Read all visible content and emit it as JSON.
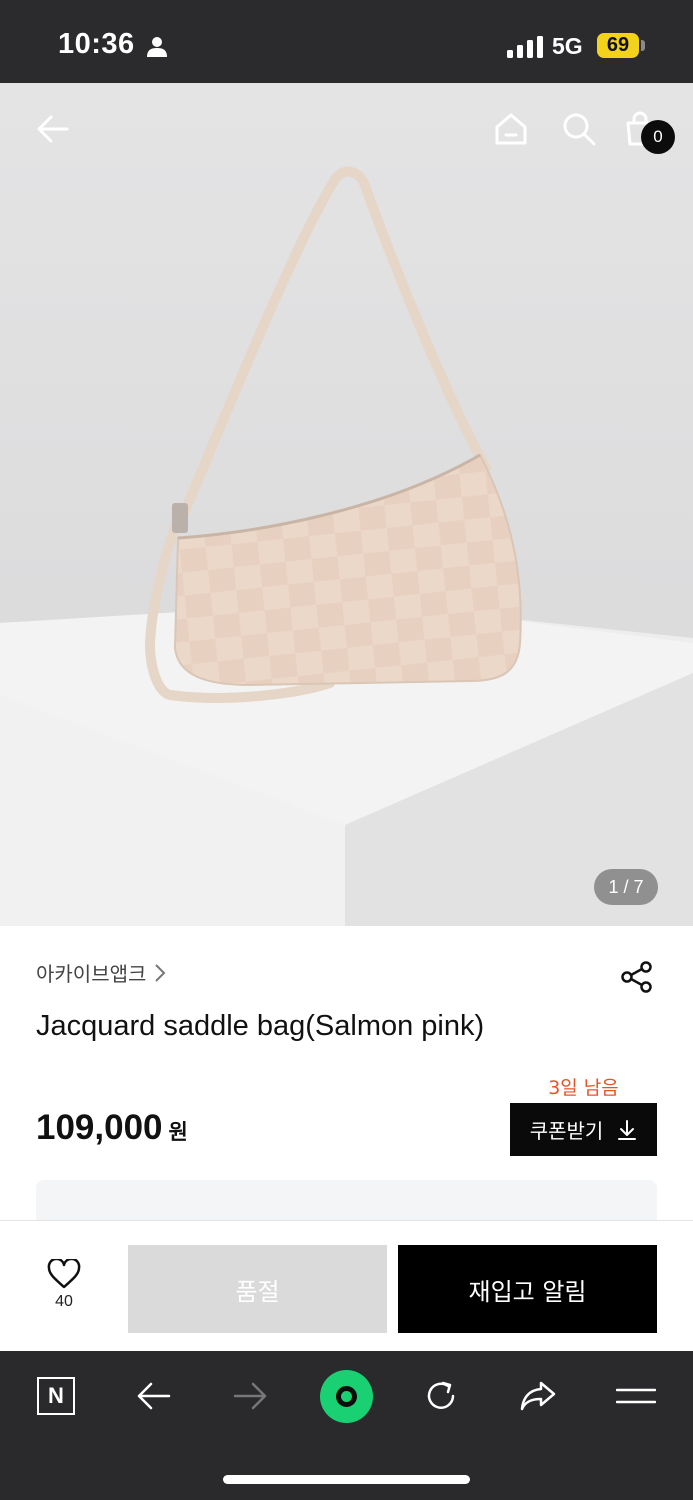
{
  "status_bar": {
    "time": "10:36",
    "network": "5G",
    "battery": "69",
    "icons": [
      "person-icon",
      "signal-bars-icon"
    ]
  },
  "header": {
    "icons": [
      "back-arrow-icon",
      "home-icon",
      "search-icon",
      "shopping-bag-icon"
    ],
    "cart_count": "0"
  },
  "gallery": {
    "page_indicator": "1 / 7"
  },
  "product": {
    "brand": "아카이브앱크",
    "title": "Jacquard saddle bag(Salmon pink)",
    "price": "109,000",
    "price_unit": "원"
  },
  "coupon": {
    "days_left": "3일 남음",
    "button_label": "쿠폰받기"
  },
  "action_bar": {
    "like_count": "40",
    "soldout_label": "품절",
    "restock_label": "재입고 알림"
  },
  "browser_toolbar": {
    "logo": "N",
    "icons": [
      "naver-logo-icon",
      "back-icon",
      "forward-icon",
      "green-dot-icon",
      "reload-icon",
      "share-icon",
      "menu-icon"
    ]
  },
  "colors": {
    "accent_orange": "#e4552a",
    "green": "#19d173",
    "black": "#0a0a0a",
    "soldout_gray": "#dadada"
  }
}
